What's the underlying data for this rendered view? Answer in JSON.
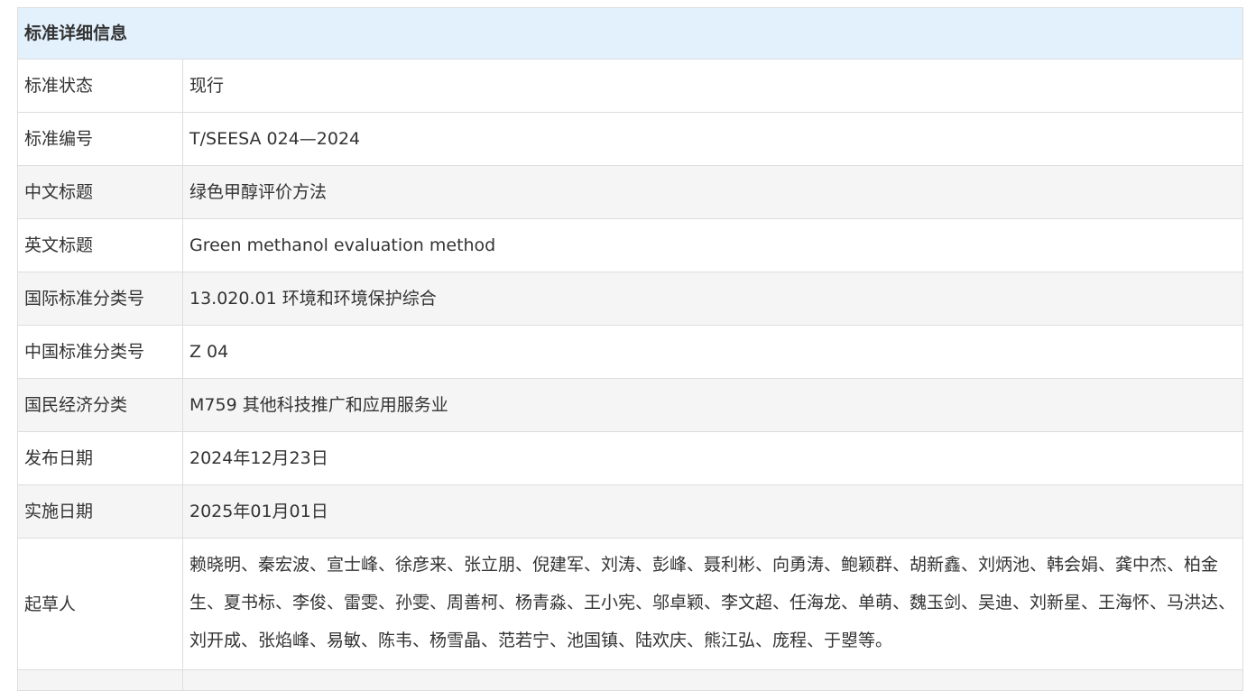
{
  "title": "标准详细信息",
  "rows": [
    {
      "label": "标准状态",
      "value": "现行"
    },
    {
      "label": "标准编号",
      "value": "T/SEESA 024—2024"
    },
    {
      "label": "中文标题",
      "value": "绿色甲醇评价方法"
    },
    {
      "label": "英文标题",
      "value": "Green methanol evaluation method"
    },
    {
      "label": "国际标准分类号",
      "value": "13.020.01 环境和环境保护综合"
    },
    {
      "label": "中国标准分类号",
      "value": "Z 04"
    },
    {
      "label": "国民经济分类",
      "value": "M759 其他科技推广和应用服务业"
    },
    {
      "label": "发布日期",
      "value": "2024年12月23日"
    },
    {
      "label": "实施日期",
      "value": "2025年01月01日"
    },
    {
      "label": "起草人",
      "value": "赖晓明、秦宏波、宣士峰、徐彦来、张立朋、倪建军、刘涛、彭峰、聂利彬、向勇涛、鲍颖群、胡新鑫、刘炳池、韩会娟、龚中杰、柏金生、夏书标、李俊、雷雯、孙雯、周善柯、杨青淼、王小宪、邬卓颖、李文超、任海龙、单萌、魏玉剑、吴迪、刘新星、王海怀、马洪达、刘开成、张焰峰、易敏、陈韦、杨雪晶、范若宁、池国镇、陆欢庆、熊江弘、庞程、于曌等。"
    }
  ]
}
